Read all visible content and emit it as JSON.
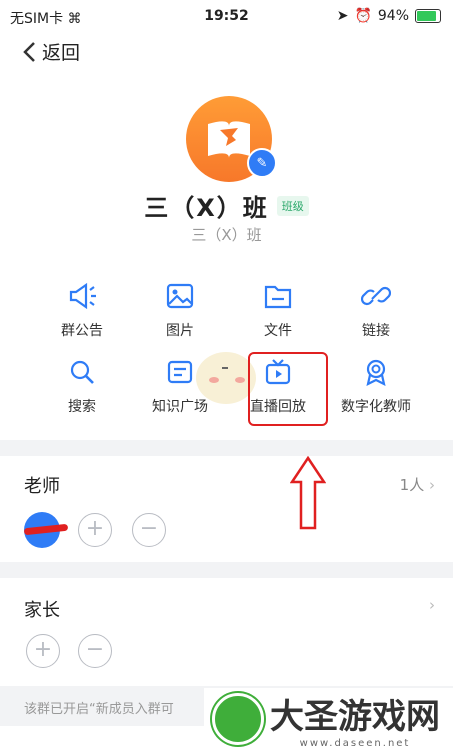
{
  "status_bar": {
    "carrier": "无SIM卡",
    "time": "19:52",
    "battery_percent": "94%",
    "battery_level": 0.94
  },
  "nav": {
    "back_label": "返回"
  },
  "group": {
    "name": "三（X）班",
    "tag": "班级",
    "subname": "三（X）班"
  },
  "grid": {
    "items": [
      {
        "label": "群公告",
        "icon": "megaphone-icon"
      },
      {
        "label": "图片",
        "icon": "image-icon"
      },
      {
        "label": "文件",
        "icon": "folder-icon"
      },
      {
        "label": "链接",
        "icon": "link-icon"
      },
      {
        "label": "搜索",
        "icon": "search-icon"
      },
      {
        "label": "知识广场",
        "icon": "knowledge-icon"
      },
      {
        "label": "直播回放",
        "icon": "live-replay-icon"
      },
      {
        "label": "数字化教师",
        "icon": "badge-icon"
      }
    ]
  },
  "teachers": {
    "title": "老师",
    "count": "1人"
  },
  "parents": {
    "title": "家长"
  },
  "notice": {
    "text": "该群已开启“新成员入群可"
  },
  "watermark": {
    "brand": "大圣游戏网",
    "domain": "www.daseen.net"
  },
  "colors": {
    "accent": "#2f7cf6",
    "avatar": "#f7882f",
    "highlight": "#e02020"
  }
}
